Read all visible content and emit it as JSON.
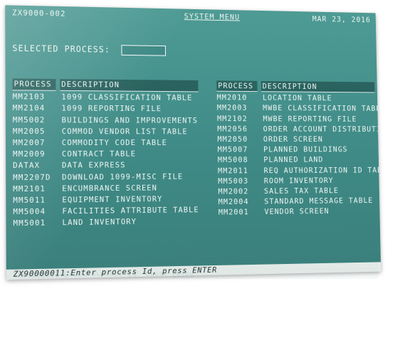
{
  "header": {
    "screen_id": "ZX9000-002",
    "title": "SYSTEM MENU",
    "date": "MAR 23, 2016"
  },
  "selected_process": {
    "label": "SELECTED PROCESS:",
    "value": ""
  },
  "columns": {
    "process_header": "PROCESS",
    "description_header": "DESCRIPTION"
  },
  "left_list": [
    {
      "process": "MM2103",
      "description": "1099 CLASSIFICATION TABLE"
    },
    {
      "process": "MM2104",
      "description": "1099 REPORTING FILE"
    },
    {
      "process": "MM5002",
      "description": "BUILDINGS AND IMPROVEMENTS"
    },
    {
      "process": "MM2005",
      "description": "COMMOD VENDOR LIST TABLE"
    },
    {
      "process": "MM2007",
      "description": "COMMODITY CODE TABLE"
    },
    {
      "process": "MM2009",
      "description": "CONTRACT TABLE"
    },
    {
      "process": "DATAX",
      "description": "DATA EXPRESS"
    },
    {
      "process": "MM2207D",
      "description": "DOWNLOAD 1099-MISC FILE"
    },
    {
      "process": "MM2101",
      "description": "ENCUMBRANCE SCREEN"
    },
    {
      "process": "MM5011",
      "description": "EQUIPMENT INVENTORY"
    },
    {
      "process": "MM5004",
      "description": "FACILITIES ATTRIBUTE TABLE"
    },
    {
      "process": "MM5001",
      "description": "LAND INVENTORY"
    }
  ],
  "right_list": [
    {
      "process": "MM2010",
      "description": "LOCATION TABLE"
    },
    {
      "process": "MM2003",
      "description": "MWBE CLASSIFICATION TABLE"
    },
    {
      "process": "MM2102",
      "description": "MWBE REPORTING FILE"
    },
    {
      "process": "MM2056",
      "description": "ORDER ACCOUNT DISTRIBUTION"
    },
    {
      "process": "MM2050",
      "description": "ORDER SCREEN"
    },
    {
      "process": "MM5007",
      "description": "PLANNED BUILDINGS"
    },
    {
      "process": "MM5008",
      "description": "PLANNED LAND"
    },
    {
      "process": "MM2011",
      "description": "REQ AUTHORIZATION ID TABLE"
    },
    {
      "process": "MM5003",
      "description": "ROOM INVENTORY"
    },
    {
      "process": "MM2002",
      "description": "SALES TAX TABLE"
    },
    {
      "process": "MM2004",
      "description": "STANDARD MESSAGE TABLE"
    },
    {
      "process": "MM2001",
      "description": "VENDOR SCREEN"
    }
  ],
  "status_bar": {
    "message": "ZX90000011:Enter process Id, press ENTER"
  },
  "colors": {
    "screen_bg": "#3f8a86",
    "text": "#eef7f4",
    "status_bg": "#e6ece9"
  }
}
